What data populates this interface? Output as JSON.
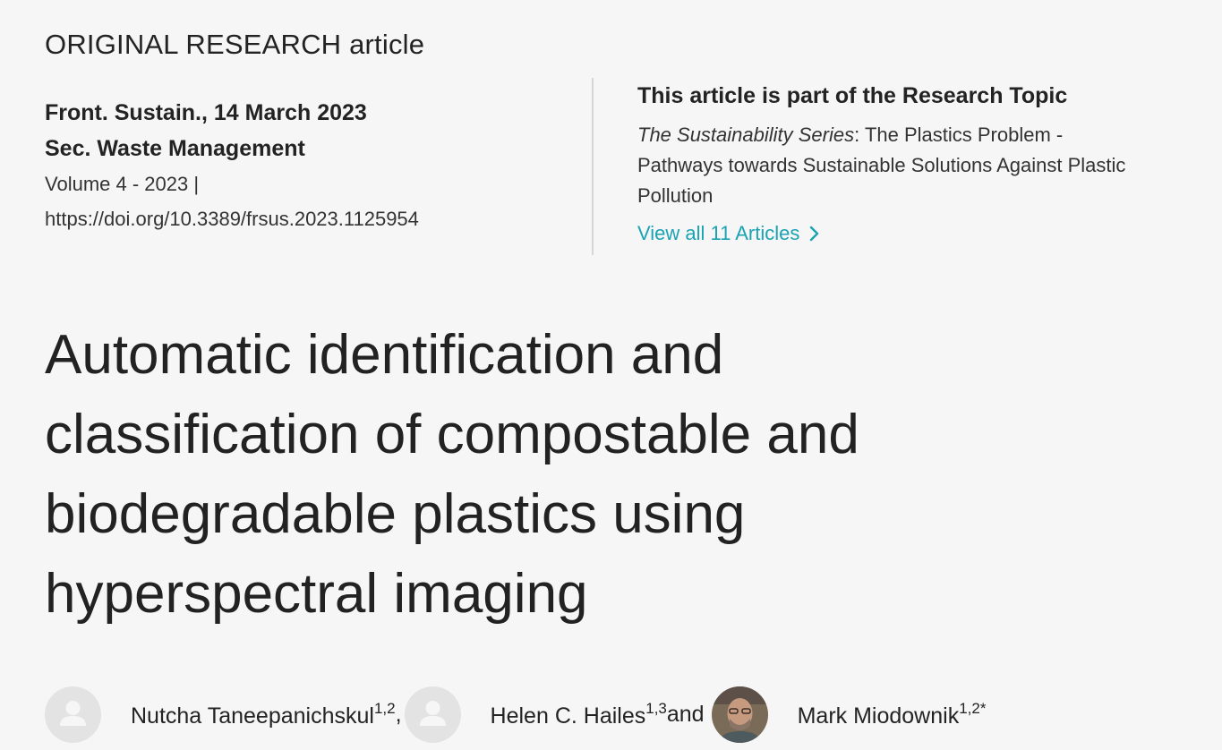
{
  "article": {
    "type_label": "ORIGINAL RESEARCH article",
    "journal_date": "Front. Sustain., 14 March 2023",
    "section": "Sec. Waste Management",
    "volume": "Volume 4 - 2023 |",
    "doi": "https://doi.org/10.3389/frsus.2023.1125954",
    "title": "Automatic identification and classification of compostable and biodegradable plastics using hyperspectral imaging"
  },
  "research_topic": {
    "heading": "This article is part of the Research Topic",
    "series_italic": "The Sustainability Series",
    "title_rest": ": The Plastics Problem - Pathways towards Sustainable Solutions Against Plastic Pollution",
    "view_all_label": "View all 11 Articles",
    "link_color": "#1aa3b2"
  },
  "authors": [
    {
      "name": "Nutcha Taneepanichskul",
      "affiliations": "1,2",
      "separator": ",",
      "avatar": "placeholder-avatar-icon"
    },
    {
      "name": "Helen C. Hailes",
      "affiliations": "1,3",
      "separator": " and",
      "avatar": "placeholder-avatar-icon"
    },
    {
      "name": "Mark Miodownik",
      "affiliations": "1,2*",
      "separator": "",
      "avatar": "author-photo"
    }
  ]
}
